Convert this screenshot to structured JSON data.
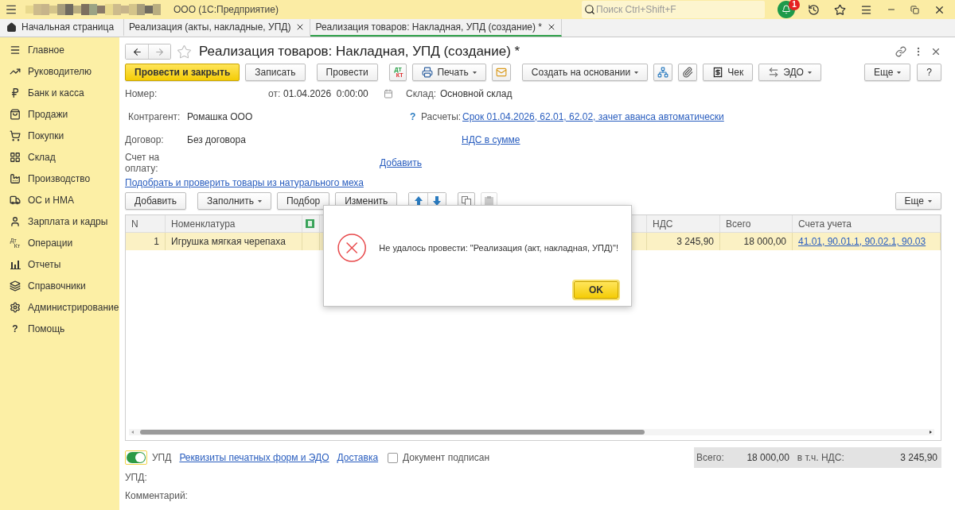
{
  "app_bar": {
    "title": "ООО (1С:Предприятие)",
    "search": {
      "placeholder": "Поиск Ctrl+Shift+F"
    },
    "notifications": "1"
  },
  "tabs": [
    {
      "label": "Начальная страница",
      "kind": "home",
      "selected": false
    },
    {
      "label": "Реализация (акты, накладные, УПД)",
      "kind": "doc",
      "selected": false
    },
    {
      "label": "Реализация товаров: Накладная, УПД (создание) *",
      "kind": "doc",
      "selected": true
    }
  ],
  "sidebar": {
    "items": [
      {
        "label": "Главное",
        "kind": "main"
      },
      {
        "label": "Руководителю",
        "kind": "trend"
      },
      {
        "label": "Банк и касса",
        "kind": "bank"
      },
      {
        "label": "Продажи",
        "kind": "bag"
      },
      {
        "label": "Покупки",
        "kind": "cart"
      },
      {
        "label": "Склад",
        "kind": "grid"
      },
      {
        "label": "Производство",
        "kind": "factory"
      },
      {
        "label": "ОС и НМА",
        "kind": "truck"
      },
      {
        "label": "Зарплата и кадры",
        "kind": "person"
      },
      {
        "label": "Операции",
        "kind": "dtkt",
        "top": "Дт",
        "bottom": "Кт"
      },
      {
        "label": "Отчеты",
        "kind": "chart"
      },
      {
        "label": "Справочники",
        "kind": "books"
      },
      {
        "label": "Администрирование",
        "kind": "gear"
      },
      {
        "label": "Помощь",
        "kind": "glyph",
        "glyph": "?"
      }
    ]
  },
  "form": {
    "title": "Реализация товаров: Накладная, УПД (создание) *",
    "toolbar": {
      "groups": [
        [
          {
            "kind": "primary",
            "label": "Провести и закрыть"
          },
          {
            "kind": "button",
            "label": "Записать"
          }
        ],
        [
          {
            "kind": "button",
            "label": "Провести"
          }
        ],
        [
          {
            "kind": "dtkt",
            "top": "ДТ",
            "bottom": "КТ"
          },
          {
            "kind": "print",
            "label": "Печать"
          },
          {
            "kind": "mail"
          }
        ],
        [
          {
            "kind": "menu",
            "label": "Создать на основании"
          },
          {
            "kind": "structure"
          },
          {
            "kind": "clip"
          },
          {
            "kind": "receipt",
            "label": "Чек"
          },
          {
            "kind": "edo",
            "label": "ЭДО"
          }
        ]
      ],
      "right": [
        {
          "kind": "menu",
          "label": "Еще"
        },
        {
          "kind": "button",
          "label": "?"
        }
      ]
    },
    "fields": {
      "number": {
        "label": "Номер:"
      },
      "date": {
        "label": "от:",
        "value": "01.04.2026  0:00:00"
      },
      "warehouse": {
        "label": "Склад:",
        "value": "Основной склад"
      },
      "counterparty": {
        "label": "Контрагент:",
        "value": "Ромашка ООО",
        "hint": "?"
      },
      "settlements": {
        "label": "Расчеты:",
        "link": "Срок 01.04.2026, 62.01, 62.02, зачет аванса автоматически"
      },
      "contract": {
        "label": "Договор:",
        "value": "Без договора"
      },
      "vat_link": "НДС в сумме",
      "invoice": {
        "label": "Счет на оплату:",
        "link": "Добавить"
      },
      "fur_link": "Подобрать и проверить товары из натурального меха"
    },
    "table_toolbar": {
      "groups": [
        [
          {
            "kind": "button",
            "label": "Добавить"
          }
        ],
        [
          {
            "kind": "menu",
            "label": "Заполнить"
          },
          {
            "kind": "button",
            "label": "Подбор"
          },
          {
            "kind": "button",
            "label": "Изменить"
          }
        ],
        [
          {
            "kind": "pair"
          }
        ],
        [
          {
            "kind": "copy"
          },
          {
            "kind": "paste",
            "disabled": true
          }
        ]
      ],
      "right": [
        {
          "kind": "menu",
          "label": "Еще"
        }
      ]
    }
  },
  "table": {
    "columns": [
      {
        "label": "N",
        "kind": "number"
      },
      {
        "label": "Номенклатура",
        "kind": "text"
      },
      {
        "kind": "icon"
      },
      {
        "kind": "hidden"
      },
      {
        "label": "НДС",
        "kind": "number"
      },
      {
        "label": "Всего",
        "kind": "number"
      },
      {
        "label": "Счета учета",
        "kind": "text"
      }
    ],
    "rows": [
      {
        "selected": true,
        "cells": [
          {
            "text": "1"
          },
          {
            "text": "Игрушка мягкая черепаха"
          },
          {},
          {},
          {
            "text": "3 245,90"
          },
          {
            "text": "18 000,00"
          },
          {
            "link": "41.01, 90.01.1, 90.02.1, 90.03"
          }
        ]
      }
    ]
  },
  "footer": {
    "toggle": {
      "label": "УПД",
      "on": true
    },
    "links": [
      "Реквизиты печатных форм и ЭДО",
      "Доставка"
    ],
    "checkbox": {
      "label": "Документ подписан",
      "checked": false
    },
    "totals": {
      "total_label": "Всего:",
      "total": "18 000,00",
      "vat_label": "в т.ч. НДС:",
      "vat": "3 245,90"
    },
    "upd_label": "УПД:",
    "comment_label": "Комментарий:"
  },
  "dialog": {
    "message": "Не удалось провести: \"Реализация (акт, накладная, УПД)\"!",
    "ok": "OK"
  }
}
